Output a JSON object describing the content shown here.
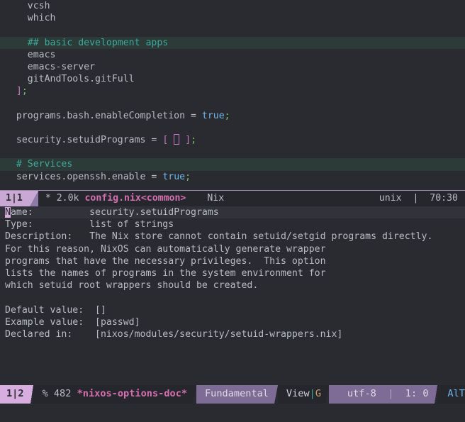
{
  "editor": {
    "lines": [
      {
        "segments": [
          {
            "text": "    vcsh",
            "cls": "c-plain"
          }
        ],
        "highlight": false
      },
      {
        "segments": [
          {
            "text": "    which",
            "cls": "c-plain"
          }
        ],
        "highlight": false
      },
      {
        "segments": [
          {
            "text": "",
            "cls": "c-plain"
          }
        ],
        "highlight": false
      },
      {
        "segments": [
          {
            "text": "    ## basic development apps",
            "cls": "c-comment"
          }
        ],
        "highlight": true
      },
      {
        "segments": [
          {
            "text": "    emacs",
            "cls": "c-plain"
          }
        ],
        "highlight": false
      },
      {
        "segments": [
          {
            "text": "    emacs-server",
            "cls": "c-plain"
          }
        ],
        "highlight": false
      },
      {
        "segments": [
          {
            "text": "    gitAndTools.gitFull",
            "cls": "c-plain"
          }
        ],
        "highlight": false
      },
      {
        "segments": [
          {
            "text": "  ",
            "cls": "c-plain"
          },
          {
            "text": "]",
            "cls": "c-bracket"
          },
          {
            "text": ";",
            "cls": "c-semi"
          }
        ],
        "highlight": false
      },
      {
        "segments": [
          {
            "text": "",
            "cls": "c-plain"
          }
        ],
        "highlight": false
      },
      {
        "segments": [
          {
            "text": "  programs.bash.enableCompletion = ",
            "cls": "c-plain"
          },
          {
            "text": "true",
            "cls": "c-bool"
          },
          {
            "text": ";",
            "cls": "c-semi"
          }
        ],
        "highlight": false
      },
      {
        "segments": [
          {
            "text": "",
            "cls": "c-plain"
          }
        ],
        "highlight": false
      },
      {
        "segments": [
          {
            "text": "  security.setuidPrograms = ",
            "cls": "c-plain"
          },
          {
            "text": "[ ",
            "cls": "c-bracket"
          },
          {
            "text": "",
            "cls": "cursor-hollow-marker"
          },
          {
            "text": " ]",
            "cls": "c-bracket"
          },
          {
            "text": ";",
            "cls": "c-semi"
          }
        ],
        "highlight": false
      },
      {
        "segments": [
          {
            "text": "",
            "cls": "c-plain"
          }
        ],
        "highlight": false
      },
      {
        "segments": [
          {
            "text": "  # Services",
            "cls": "c-comment"
          }
        ],
        "highlight": true
      },
      {
        "segments": [
          {
            "text": "  services.openssh.enable = ",
            "cls": "c-plain"
          },
          {
            "text": "true",
            "cls": "c-bool"
          },
          {
            "text": ";",
            "cls": "c-semi"
          }
        ],
        "highlight": false
      }
    ]
  },
  "modeline_top": {
    "position": "1|1",
    "modified_indicator": "*",
    "size": "2.0k",
    "buffer_name": "config.nix<common>",
    "major_mode": "Nix",
    "coding": "unix",
    "separator": "|",
    "point": "70:30"
  },
  "doc": {
    "lines": [
      {
        "text": "Name:          security.setuidPrograms",
        "current": true,
        "cursor_char": "N"
      },
      {
        "text": "Type:          list of strings",
        "current": false
      },
      {
        "text": "Description:   The Nix store cannot contain setuid/setgid programs directly.",
        "current": false
      },
      {
        "text": "For this reason, NixOS can automatically generate wrapper",
        "current": false
      },
      {
        "text": "programs that have the necessary privileges.  This option",
        "current": false
      },
      {
        "text": "lists the names of programs in the system environment for",
        "current": false
      },
      {
        "text": "which setuid root wrappers should be created.",
        "current": false
      },
      {
        "text": "",
        "current": false
      },
      {
        "text": "Default value:  []",
        "current": false
      },
      {
        "text": "Example value:  [passwd]",
        "current": false
      },
      {
        "text": "Declared in:    [nixos/modules/security/setuid-wrappers.nix]",
        "current": false
      }
    ]
  },
  "modeline_bottom": {
    "position": "1|2",
    "percent": "%",
    "size": "482",
    "buffer_name": "*nixos-options-doc*",
    "major_mode": "Fundamental",
    "minor_view": "View",
    "minor_separator": "|",
    "minor_g": "G",
    "coding": "utf-8",
    "coding_separator": "|",
    "point": "1: 0",
    "tail": "AlT"
  },
  "colors": {
    "background": "#2a2b31",
    "comment": "#3fa89b",
    "comment_bg": "#2c3a38",
    "boolean": "#6cb6e8",
    "punct": "#c678c8",
    "semicolon": "#7bbf6a",
    "modeline_top_bg": "#8d7aa8",
    "modeline_pos_bg": "#c9a9d4",
    "modeline_dark": "#26272c",
    "buffer_name": "#d46fb0",
    "cursor": "#d8aee0",
    "purple_segment": "#7e6c97",
    "foreground": "#b9bcc4"
  }
}
